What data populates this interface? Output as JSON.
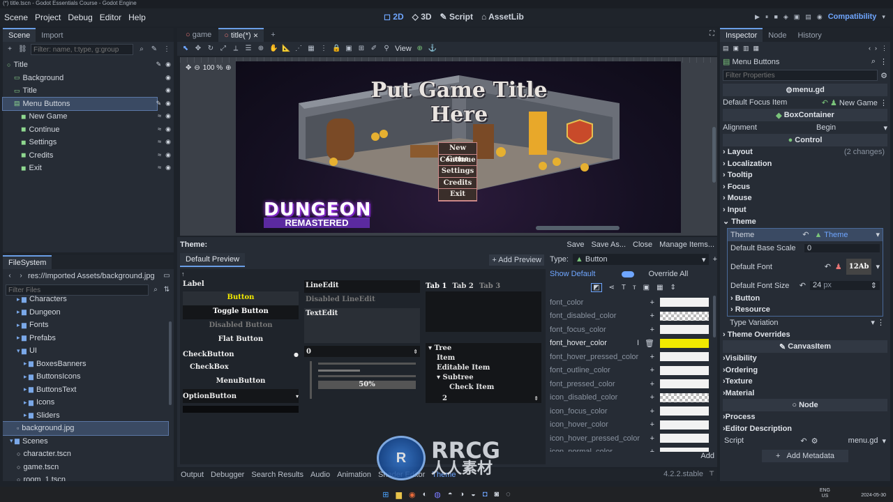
{
  "window": {
    "title": "(*) title.tscn - Godot Essentials Course - Godot Engine"
  },
  "menu": [
    "Scene",
    "Project",
    "Debug",
    "Editor",
    "Help"
  ],
  "workspaces": [
    "2D",
    "3D",
    "Script",
    "AssetLib"
  ],
  "renderer": "Compatibility",
  "scene_dock": {
    "tabs": [
      "Scene",
      "Import"
    ],
    "filter_placeholder": "Filter: name, t:type, g:group",
    "nodes": [
      {
        "label": "Title",
        "depth": 0,
        "type": "root"
      },
      {
        "label": "Background",
        "depth": 1,
        "type": "rect"
      },
      {
        "label": "Title",
        "depth": 1,
        "type": "label"
      },
      {
        "label": "Menu Buttons",
        "depth": 1,
        "type": "box"
      },
      {
        "label": "New Game",
        "depth": 2,
        "type": "button"
      },
      {
        "label": "Continue",
        "depth": 2,
        "type": "button"
      },
      {
        "label": "Settings",
        "depth": 2,
        "type": "button"
      },
      {
        "label": "Credits",
        "depth": 2,
        "type": "button"
      },
      {
        "label": "Exit",
        "depth": 2,
        "type": "button"
      }
    ]
  },
  "filesystem_dock": {
    "tab": "FileSystem",
    "path": "res://Imported Assets/background.jpg",
    "filter_placeholder": "Filter Files",
    "items": [
      {
        "label": "Characters",
        "depth": 1,
        "kind": "folder"
      },
      {
        "label": "Dungeon",
        "depth": 1,
        "kind": "folder"
      },
      {
        "label": "Fonts",
        "depth": 1,
        "kind": "folder"
      },
      {
        "label": "Prefabs",
        "depth": 1,
        "kind": "folder"
      },
      {
        "label": "UI",
        "depth": 1,
        "kind": "folder-open"
      },
      {
        "label": "BoxesBanners",
        "depth": 2,
        "kind": "folder"
      },
      {
        "label": "ButtonsIcons",
        "depth": 2,
        "kind": "folder"
      },
      {
        "label": "ButtonsText",
        "depth": 2,
        "kind": "folder"
      },
      {
        "label": "Icons",
        "depth": 2,
        "kind": "folder"
      },
      {
        "label": "Sliders",
        "depth": 2,
        "kind": "folder"
      },
      {
        "label": "background.jpg",
        "depth": 1,
        "kind": "file-selected"
      },
      {
        "label": "Scenes",
        "depth": 0,
        "kind": "folder-open"
      },
      {
        "label": "character.tscn",
        "depth": 1,
        "kind": "scene"
      },
      {
        "label": "game.tscn",
        "depth": 1,
        "kind": "scene"
      },
      {
        "label": "room_1.tscn",
        "depth": 1,
        "kind": "scene"
      }
    ]
  },
  "editor_tabs": [
    "game",
    "title(*)"
  ],
  "viewport": {
    "zoom": "100 %",
    "view_label": "View",
    "game_title": "Put Game Title Here",
    "menu_buttons": [
      "New Game",
      "Continue",
      "Settings",
      "Credits",
      "Exit"
    ],
    "logo_top": "DUNGEON",
    "logo_bottom": "REMASTERED"
  },
  "theme_editor": {
    "title": "Theme:",
    "actions": [
      "Save",
      "Save As...",
      "Close",
      "Manage Items..."
    ],
    "preview_tab": "Default Preview",
    "add_preview": "+ Add Preview",
    "preview": {
      "label": "Label",
      "button": "Button",
      "toggle_button": "Toggle Button",
      "disabled_button": "Disabled Button",
      "flat_button": "Flat Button",
      "check_button": "CheckButton",
      "check_box": "CheckBox",
      "menu_button": "MenuButton",
      "option_button": "OptionButton",
      "line_edit": "LineEdit",
      "disabled_line_edit": "Disabled LineEdit",
      "text_edit": "TextEdit",
      "spin_value": "0",
      "progress": "50%",
      "tabs": [
        "Tab 1",
        "Tab 2",
        "Tab 3"
      ],
      "tree": [
        "Tree",
        "Item",
        "Editable Item",
        "Subtree",
        "Check Item"
      ],
      "tree_spin": "2"
    },
    "type_label": "Type:",
    "type_value": "Button",
    "show_default": "Show Default",
    "override_all": "Override All",
    "properties": [
      {
        "name": "font_color",
        "swatch": "#f2f2f2",
        "overridden": false
      },
      {
        "name": "font_disabled_color",
        "swatch": "checker",
        "overridden": false
      },
      {
        "name": "font_focus_color",
        "swatch": "#f2f2f2",
        "overridden": false
      },
      {
        "name": "font_hover_color",
        "swatch": "#f2ea00",
        "overridden": true
      },
      {
        "name": "font_hover_pressed_color",
        "swatch": "#f2f2f2",
        "overridden": false
      },
      {
        "name": "font_outline_color",
        "swatch": "#f2f2f2",
        "overridden": false
      },
      {
        "name": "font_pressed_color",
        "swatch": "#f2f2f2",
        "overridden": false
      },
      {
        "name": "icon_disabled_color",
        "swatch": "checker",
        "overridden": false
      },
      {
        "name": "icon_focus_color",
        "swatch": "#f2f2f2",
        "overridden": false
      },
      {
        "name": "icon_hover_color",
        "swatch": "#f2f2f2",
        "overridden": false
      },
      {
        "name": "icon_hover_pressed_color",
        "swatch": "#f2f2f2",
        "overridden": false
      },
      {
        "name": "icon_normal_color",
        "swatch": "#f2f2f2",
        "overridden": false
      }
    ],
    "add_button": "Add"
  },
  "bottom_panel": {
    "tabs": [
      "Output",
      "Debugger",
      "Search Results",
      "Audio",
      "Animation",
      "Shader Editor",
      "Theme"
    ],
    "version": "4.2.2.stable"
  },
  "inspector": {
    "tabs": [
      "Inspector",
      "Node",
      "History"
    ],
    "object": "Menu Buttons",
    "filter_placeholder": "Filter Properties",
    "script_header": "menu.gd",
    "default_focus_label": "Default Focus Item",
    "default_focus_value": "New Game",
    "box_container": "BoxContainer",
    "alignment_label": "Alignment",
    "alignment_value": "Begin",
    "control": "Control",
    "categories": [
      "Layout",
      "Localization",
      "Tooltip",
      "Focus",
      "Mouse",
      "Input",
      "Theme"
    ],
    "layout_changes": "(2 changes)",
    "theme_label": "Theme",
    "theme_value": "Theme",
    "base_scale_label": "Default Base Scale",
    "base_scale_value": "0",
    "default_font_label": "Default Font",
    "default_font_preview": "12Ab",
    "font_size_label": "Default Font Size",
    "font_size_value": "24",
    "font_size_unit": "px",
    "sub_categories": [
      "Button",
      "Resource"
    ],
    "type_variation": "Type Variation",
    "theme_overrides": "Theme Overrides",
    "canvas_item": "CanvasItem",
    "canvas_categories": [
      "Visibility",
      "Ordering",
      "Texture",
      "Material"
    ],
    "node_section": "Node",
    "node_categories": [
      "Process",
      "Editor Description"
    ],
    "script_label": "Script",
    "script_value": "menu.gd",
    "add_metadata": "Add Metadata"
  },
  "taskbar": {
    "lang": "ENG",
    "region": "US",
    "date": "2024-05-30"
  },
  "watermark": {
    "brand": "RRCG",
    "sub": "人人素材"
  }
}
